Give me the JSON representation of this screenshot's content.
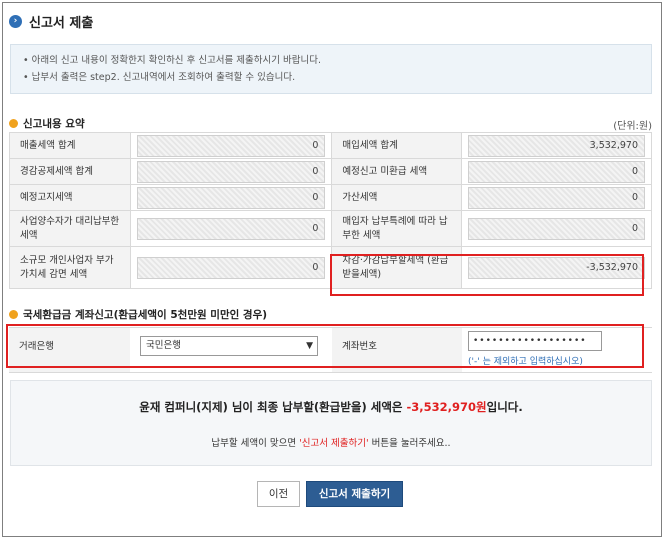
{
  "title": "신고서 제출",
  "title_icon": "chevron-right-circle-icon",
  "notice": [
    "아래의 신고 내용이 정확한지 확인하신 후 신고서를 제출하시기 바랍니다.",
    "납부서 출력은 step2. 신고내역에서 조회하여 출력할 수 있습니다."
  ],
  "summary": {
    "heading": "신고내용 요약",
    "unit": "(단위:원)",
    "rows": [
      {
        "left_label": "매출세액 합계",
        "left_value": "0",
        "right_label": "매입세액 합계",
        "right_value": "3,532,970"
      },
      {
        "left_label": "경감공제세액 합계",
        "left_value": "0",
        "right_label": "예정신고 미환급 세액",
        "right_value": "0"
      },
      {
        "left_label": "예정고지세액",
        "left_value": "0",
        "right_label": "가산세액",
        "right_value": "0"
      },
      {
        "left_label": "사업양수자가 대리납부한 세액",
        "left_value": "0",
        "right_label": "매입자 납부특례에 따라 납부한 세액",
        "right_value": "0"
      },
      {
        "left_label": "소규모 개인사업자 부가가치세 감면 세액",
        "left_value": "0",
        "right_label": "차감·가감납부할세액 (환급받을세액)",
        "right_value": "-3,532,970"
      }
    ]
  },
  "refund": {
    "heading": "국세환급금 계좌신고(환급세액이 5천만원 미만인 경우)",
    "bank_label": "거래은행",
    "bank_value": "국민은행",
    "account_label": "계좌번호",
    "account_value": "••••••••••••••••••",
    "hint": "('-' 는 제외하고 입력하십시오)"
  },
  "final": {
    "msg_prefix": "윤재 컴퍼니(지제) 님이 최종 납부할(환급받을) 세액은 ",
    "amount": "-3,532,970원",
    "msg_suffix": "입니다.",
    "msg2_prefix": "납부할 세액이 맞으면 ",
    "msg2_highlight": "'신고서 제출하기'",
    "msg2_suffix": " 버튼을 눌러주세요.."
  },
  "buttons": {
    "prev": "이전",
    "submit": "신고서 제출하기"
  },
  "colors": {
    "accent": "#2d5d93",
    "highlight": "#e02020",
    "bullet": "#f0a21e"
  }
}
